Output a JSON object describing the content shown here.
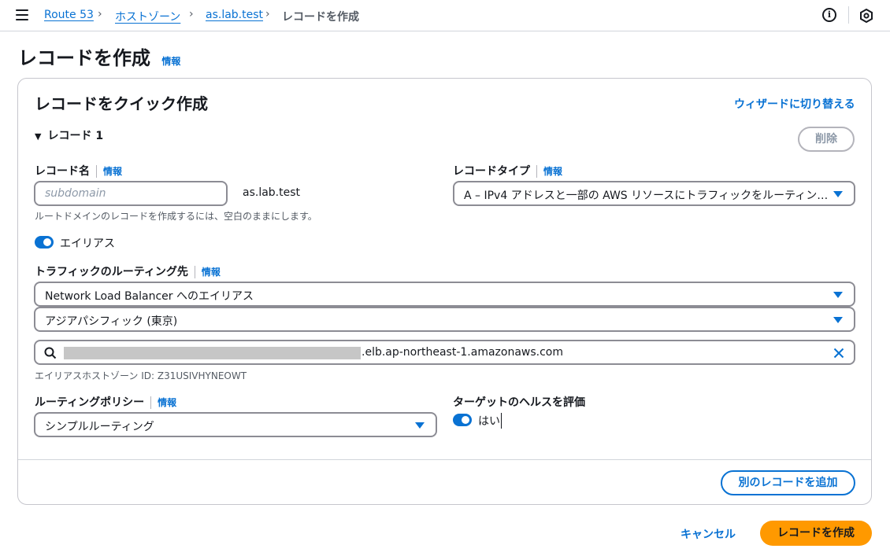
{
  "breadcrumb": {
    "items": [
      "Route 53",
      "ホストゾーン",
      "as.lab.test"
    ],
    "current": "レコードを作成"
  },
  "page": {
    "title": "レコードを作成",
    "info": "情報"
  },
  "card": {
    "title": "レコードをクイック作成",
    "wizard_link": "ウィザードに切り替える",
    "record_heading": "レコード 1",
    "delete_button": "削除"
  },
  "record_name": {
    "label": "レコード名",
    "info": "情報",
    "placeholder": "subdomain",
    "suffix": "as.lab.test",
    "hint": "ルートドメインのレコードを作成するには、空白のままにします。"
  },
  "record_type": {
    "label": "レコードタイプ",
    "info": "情報",
    "value": "A – IPv4 アドレスと一部の AWS リソースにトラフィックをルーティン…"
  },
  "alias": {
    "label": "エイリアス",
    "enabled": true
  },
  "traffic_target": {
    "label": "トラフィックのルーティング先",
    "info": "情報",
    "endpoint_type": "Network Load Balancer へのエイリアス",
    "region": "アジアパシフィック (東京)",
    "endpoint_suffix": ".elb.ap-northeast-1.amazonaws.com",
    "hosted_zone_hint": "エイリアスホストゾーン ID: Z31USIVHYNEOWT"
  },
  "routing_policy": {
    "label": "ルーティングポリシー",
    "info": "情報",
    "value": "シンプルルーティング"
  },
  "health": {
    "label": "ターゲットのヘルスを評価",
    "value": "はい",
    "enabled": true
  },
  "actions": {
    "add_record": "別のレコードを追加",
    "cancel": "キャンセル",
    "create": "レコードを作成"
  },
  "colors": {
    "accent": "#0972d3",
    "primary_button": "#ff9900"
  }
}
